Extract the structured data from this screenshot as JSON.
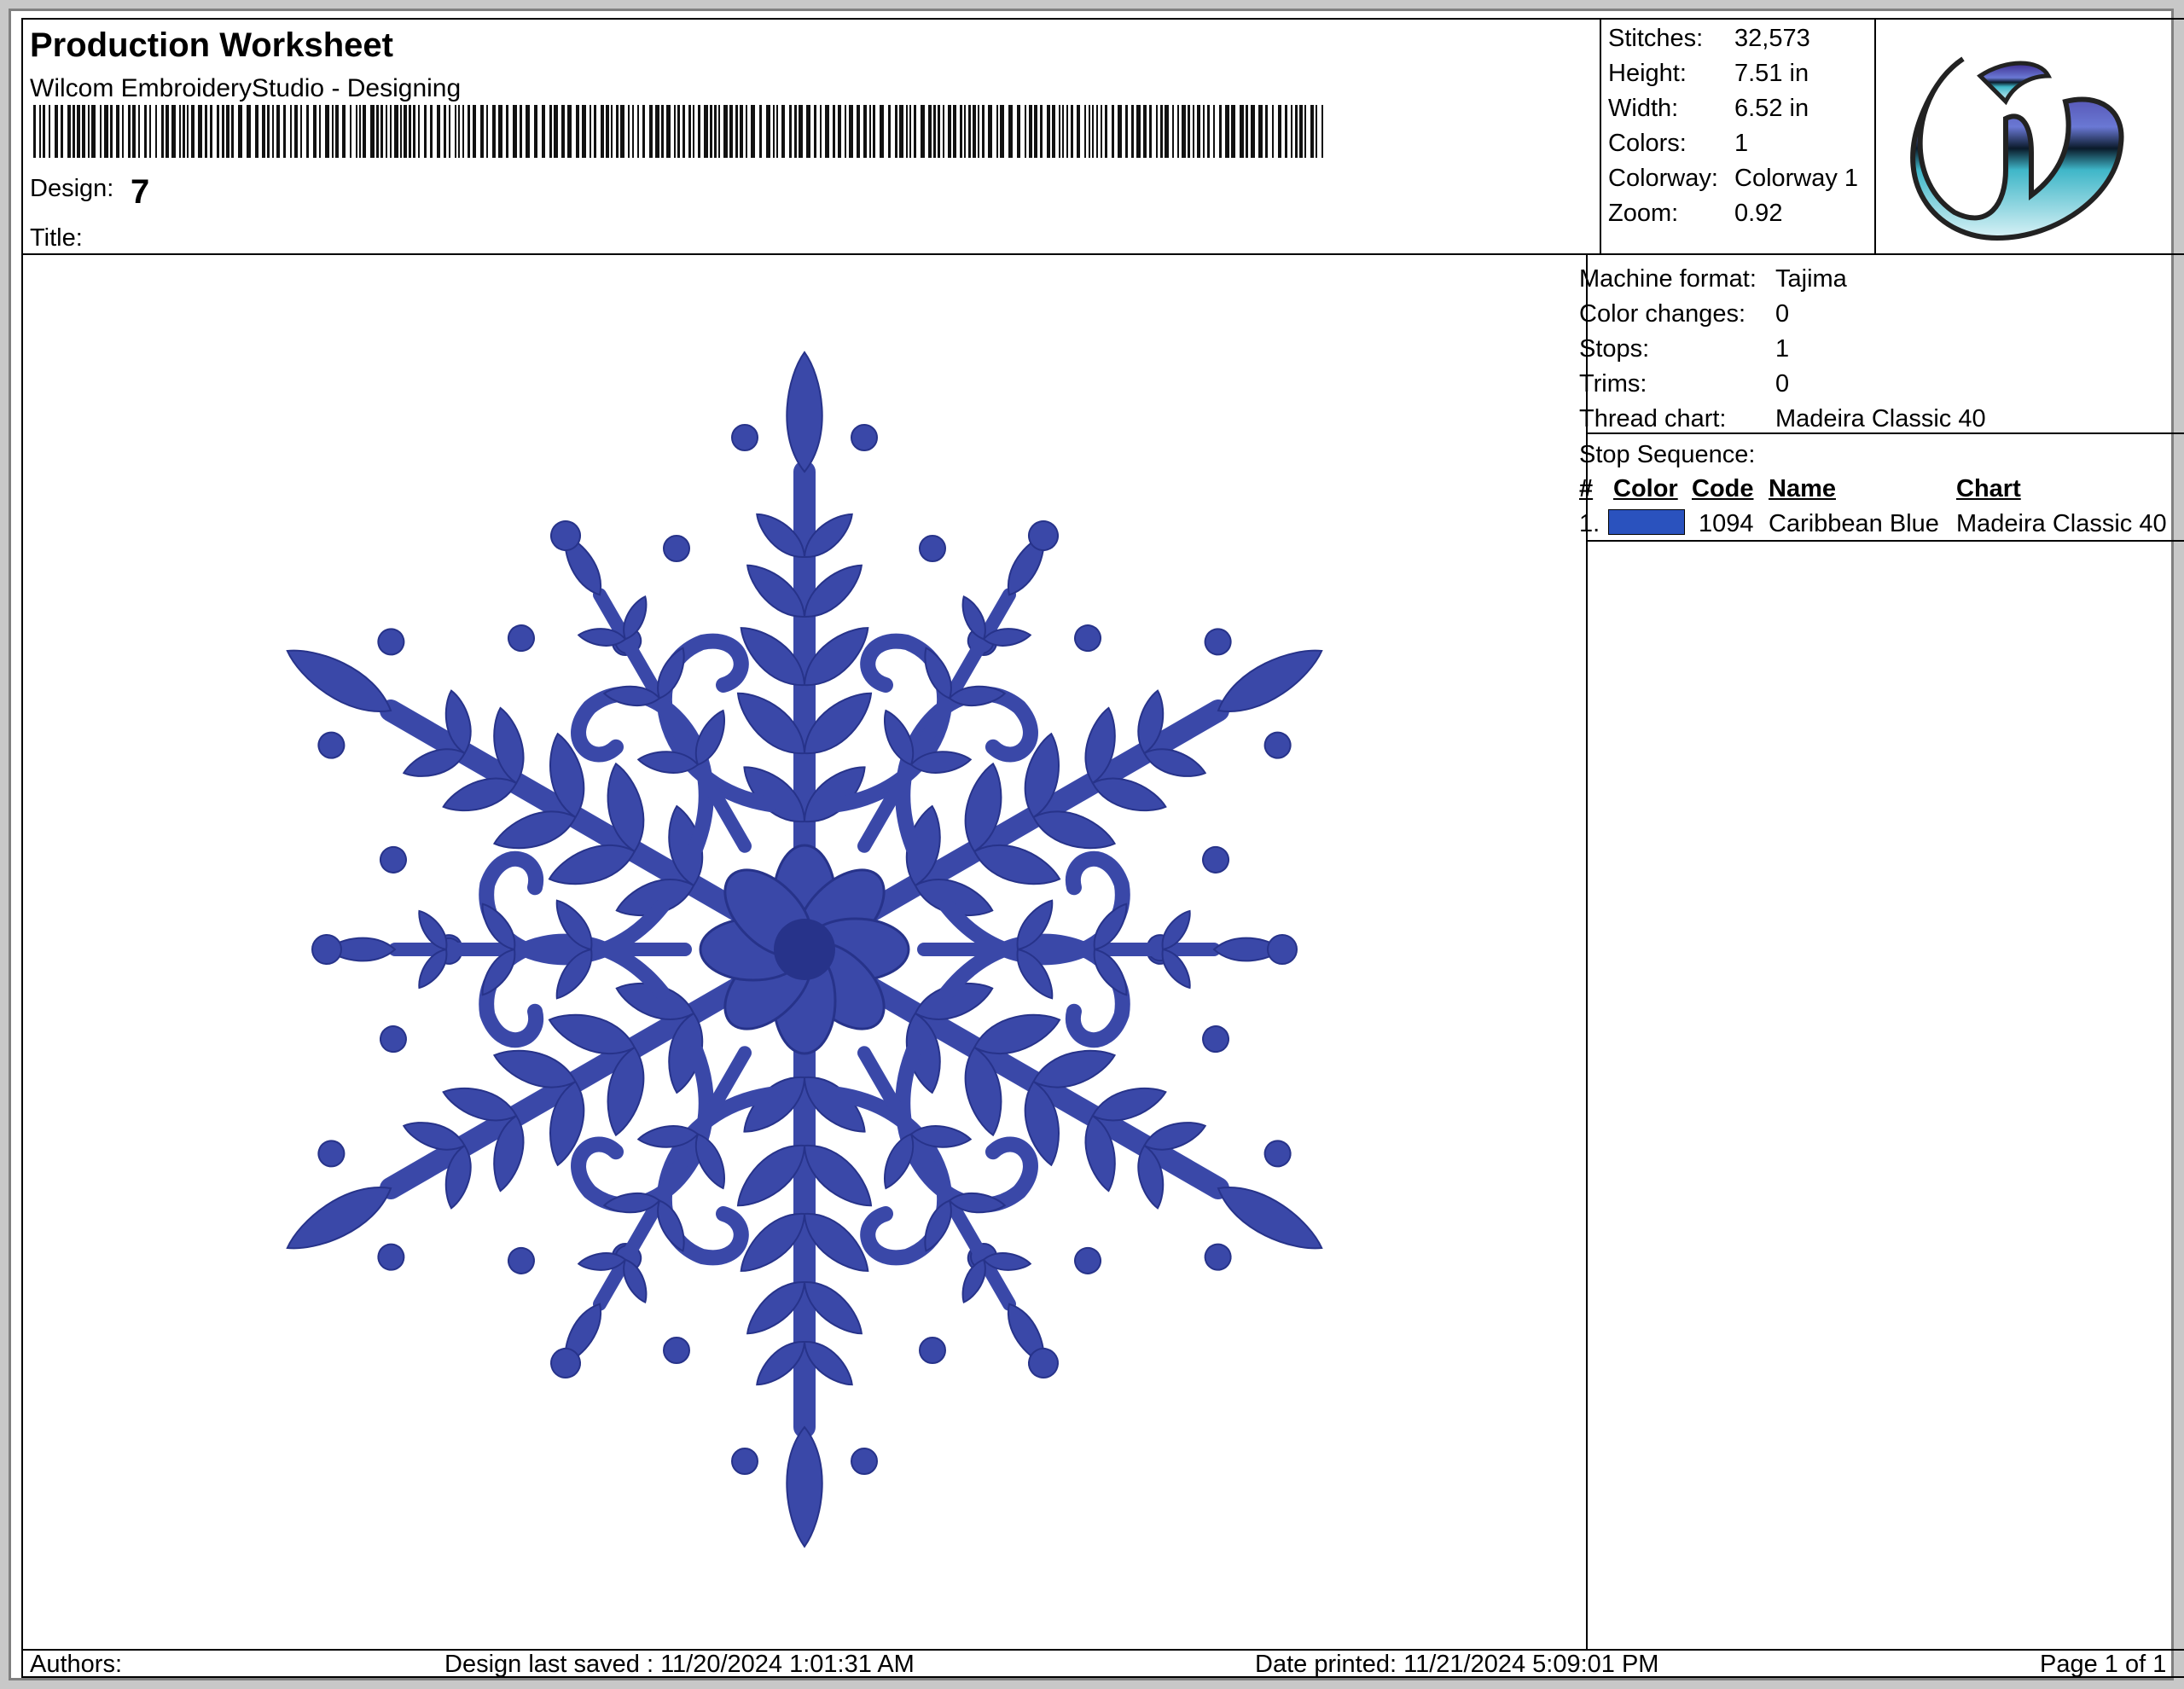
{
  "header": {
    "title": "Production Worksheet",
    "software": "Wilcom EmbroideryStudio - Designing",
    "design_label": "Design:",
    "design_value": "7",
    "title_label": "Title:",
    "title_value": ""
  },
  "stats": {
    "stitches_label": "Stitches:",
    "stitches_value": "32,573",
    "height_label": "Height:",
    "height_value": "7.51 in",
    "width_label": "Width:",
    "width_value": "6.52 in",
    "colors_label": "Colors:",
    "colors_value": "1",
    "colorway_label": "Colorway:",
    "colorway_value": "Colorway 1",
    "zoom_label": "Zoom:",
    "zoom_value": "0.92"
  },
  "machine": {
    "format_label": "Machine format:",
    "format_value": "Tajima",
    "color_changes_label": "Color changes:",
    "color_changes_value": "0",
    "stops_label": "Stops:",
    "stops_value": "1",
    "trims_label": "Trims:",
    "trims_value": "0",
    "thread_chart_label": "Thread chart:",
    "thread_chart_value": "Madeira Classic 40"
  },
  "stop_sequence": {
    "label": "Stop Sequence:",
    "columns": [
      "#",
      "Color",
      "Code",
      "Name",
      "Chart"
    ],
    "rows": [
      {
        "num": "1.",
        "swatch": "#2a52be",
        "code": "1094",
        "name": "Caribbean Blue",
        "chart": "Madeira Classic 40"
      }
    ]
  },
  "footer": {
    "authors_label": "Authors:",
    "last_saved": "Design last saved : 11/20/2024 1:01:31 AM",
    "date_printed": "Date printed: 11/21/2024 5:09:01 PM",
    "page": "Page 1 of 1"
  },
  "colors": {
    "thread": "#3a48a8",
    "thread_dark": "#27338a"
  }
}
